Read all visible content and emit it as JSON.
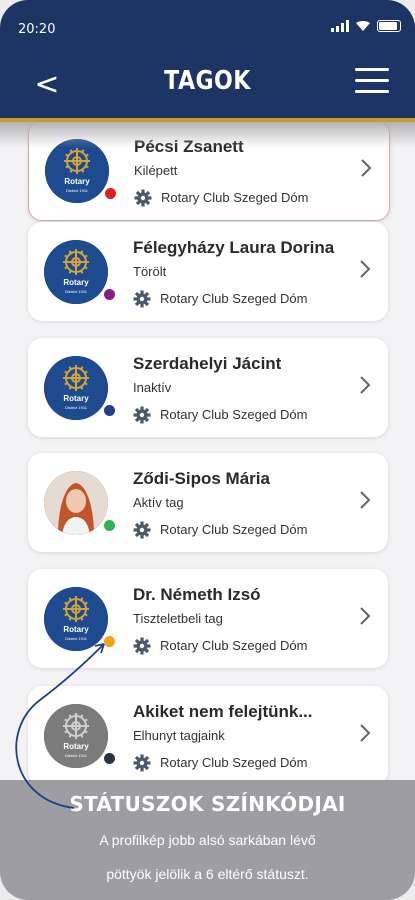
{
  "status_bar": {
    "time": "20:20"
  },
  "header": {
    "title": "TAGOK",
    "back_icon": "back-arrow-icon",
    "menu_icon": "hamburger-menu-icon"
  },
  "colors": {
    "navy": "#1c3564",
    "gold": "#c99a2e"
  },
  "members": [
    {
      "name": "Pécsi Zsanett",
      "status": "Kilépett",
      "club": "Rotary Club Szeged Dóm",
      "dot_color": "#e02020",
      "avatar": "rotary-logo"
    },
    {
      "name": "Félegyházy Laura Dorina",
      "status": "Törölt",
      "club": "Rotary Club Szeged Dóm",
      "dot_color": "#8b1a8b",
      "avatar": "rotary-logo"
    },
    {
      "name": "Szerdahelyi Jácint",
      "status": "Inaktív",
      "club": "Rotary Club Szeged Dóm",
      "dot_color": "#1e3f8a",
      "avatar": "rotary-logo"
    },
    {
      "name": "Ződi-Sipos Mária",
      "status": "Aktív tag",
      "club": "Rotary Club Szeged Dóm",
      "dot_color": "#2db34a",
      "avatar": "photo"
    },
    {
      "name": "Dr. Németh Izsó",
      "status": "Tiszteletbeli tag",
      "club": "Rotary Club Szeged Dóm",
      "dot_color": "#f2a31b",
      "avatar": "rotary-logo"
    },
    {
      "name": "Akiket nem felejtünk...",
      "status": "Elhunyt tagjaink",
      "club": "Rotary Club Szeged Dóm",
      "dot_color": "#2a3340",
      "avatar": "rotary-logo-gray"
    }
  ],
  "overlay": {
    "title": "STÁTUSZOK SZÍNKÓDJAI",
    "line1": "A profilkép jobb alsó sarkában lévő",
    "line2": "pöttyök jelölik a 6 eltérő státuszt."
  }
}
